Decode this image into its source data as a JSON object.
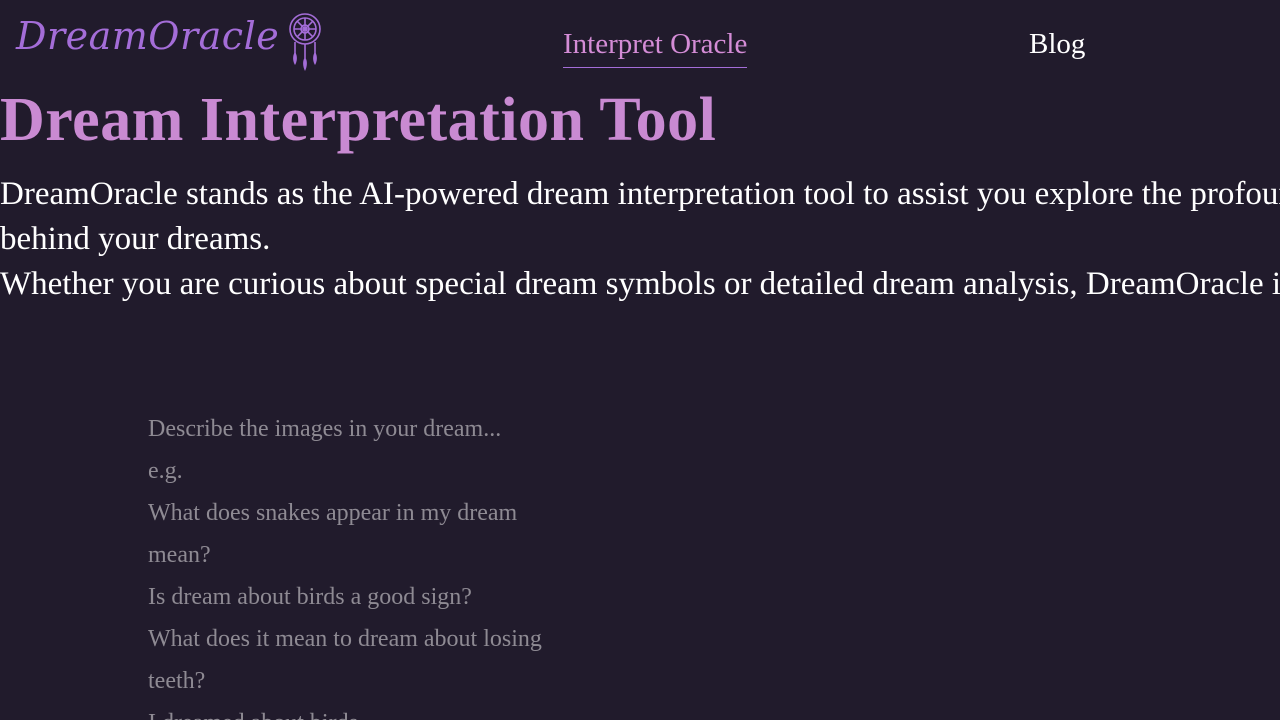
{
  "header": {
    "logo_text": "DreamOracle",
    "logo_icon": "dreamcatcher-icon",
    "nav": {
      "interpret_label": "Interpret Oracle",
      "blog_label": "Blog"
    }
  },
  "hero": {
    "title": "Dream Interpretation Tool",
    "paragraph_line1": "DreamOracle stands as the AI-powered dream interpretation tool to assist you explore the profound meanings",
    "paragraph_line2": "behind your dreams.",
    "paragraph_line3": "Whether you are curious about special dream symbols or detailed dream analysis, DreamOracle is here to help."
  },
  "dream_input": {
    "value": "",
    "placeholder": "Describe the images in your dream...\ne.g.\nWhat does snakes appear in my dream mean?\nIs dream about birds a good sign?\nWhat does it mean to dream about losing teeth?\nI dreamed about birds.\nI dreamed about losing my teeth."
  },
  "colors": {
    "background": "#211b2c",
    "accent": "#c98ad2",
    "logo": "#a46dd8",
    "placeholder": "#8e8a93"
  }
}
